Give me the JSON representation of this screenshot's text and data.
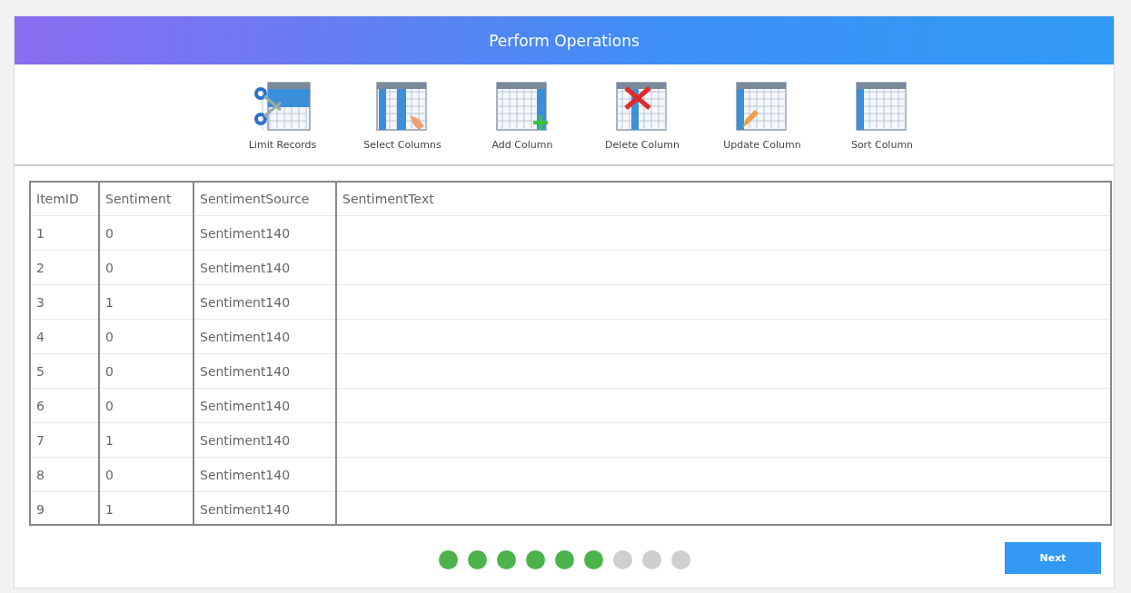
{
  "header": {
    "title": "Perform Operations"
  },
  "tools": [
    {
      "kind": "limit",
      "label": "Limit Records"
    },
    {
      "kind": "select",
      "label": "Select Columns"
    },
    {
      "kind": "add",
      "label": "Add Column"
    },
    {
      "kind": "delete",
      "label": "Delete Column"
    },
    {
      "kind": "update",
      "label": "Update Column"
    },
    {
      "kind": "sort",
      "label": "Sort Column"
    }
  ],
  "table": {
    "columns": [
      "ItemID",
      "Sentiment",
      "SentimentSource",
      "SentimentText"
    ],
    "rows": [
      [
        "1",
        "0",
        "Sentiment140"
      ],
      [
        "2",
        "0",
        "Sentiment140"
      ],
      [
        "3",
        "1",
        "Sentiment140"
      ],
      [
        "4",
        "0",
        "Sentiment140"
      ],
      [
        "5",
        "0",
        "Sentiment140"
      ],
      [
        "6",
        "0",
        "Sentiment140"
      ],
      [
        "7",
        "1",
        "Sentiment140"
      ],
      [
        "8",
        "0",
        "Sentiment140"
      ],
      [
        "9",
        "1",
        "Sentiment140"
      ]
    ]
  },
  "steps": [
    {
      "completed": true
    },
    {
      "completed": true
    },
    {
      "completed": true
    },
    {
      "completed": true
    },
    {
      "completed": true
    },
    {
      "completed": true
    },
    {
      "completed": false
    },
    {
      "completed": false
    },
    {
      "completed": false
    }
  ],
  "next_button": "Next"
}
